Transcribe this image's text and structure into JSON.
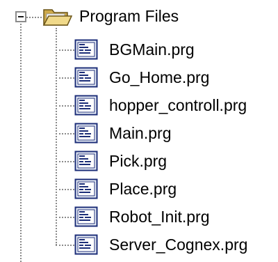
{
  "tree": {
    "root": {
      "label": "Program Files",
      "icon": "open-folder-icon",
      "expanded": true
    },
    "files": [
      {
        "label": "BGMain.prg",
        "icon": "program-file-icon"
      },
      {
        "label": "Go_Home.prg",
        "icon": "program-file-icon"
      },
      {
        "label": "hopper_controll.prg",
        "icon": "program-file-icon"
      },
      {
        "label": "Main.prg",
        "icon": "program-file-icon"
      },
      {
        "label": "Pick.prg",
        "icon": "program-file-icon"
      },
      {
        "label": "Place.prg",
        "icon": "program-file-icon"
      },
      {
        "label": "Robot_Init.prg",
        "icon": "program-file-icon"
      },
      {
        "label": "Server_Cognex.prg",
        "icon": "program-file-icon"
      }
    ]
  },
  "colors": {
    "connector": "#8a8a8a",
    "folder": "#e2c56a",
    "file_icon_border": "#1c2e78",
    "file_icon_fill": "#eef3fa",
    "text": "#000000"
  }
}
